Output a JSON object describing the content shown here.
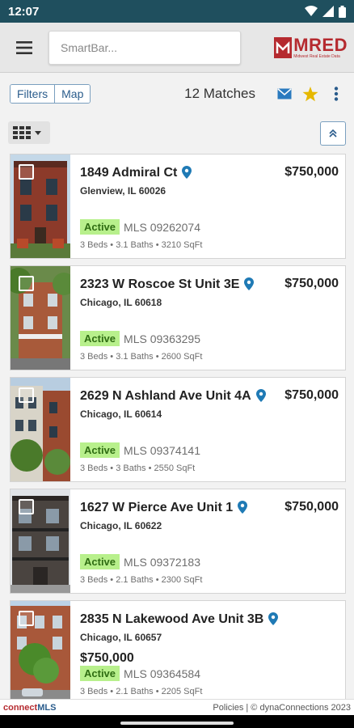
{
  "status": {
    "time": "12:07"
  },
  "topbar": {
    "search_placeholder": "SmartBar...",
    "logo_text": "MRED",
    "logo_sub": "Midwest Real Estate Data"
  },
  "toolbar": {
    "filters": "Filters",
    "map": "Map",
    "matches": "12 Matches"
  },
  "listings": [
    {
      "address": "1849 Admiral Ct",
      "city": "Glenview, IL 60026",
      "price": "$750,000",
      "status": "Active",
      "mls": "MLS 09262074",
      "details": "3 Beds • 3.1 Baths • 3210 SqFt"
    },
    {
      "address": "2323 W Roscoe St Unit 3E",
      "city": "Chicago, IL 60618",
      "price": "$750,000",
      "status": "Active",
      "mls": "MLS 09363295",
      "details": "3 Beds • 3.1 Baths • 2600 SqFt"
    },
    {
      "address": "2629 N Ashland Ave Unit 4A",
      "city": "Chicago, IL 60614",
      "price": "$750,000",
      "status": "Active",
      "mls": "MLS 09374141",
      "details": "3 Beds • 3 Baths • 2550 SqFt"
    },
    {
      "address": "1627 W Pierce Ave Unit 1",
      "city": "Chicago, IL 60622",
      "price": "$750,000",
      "status": "Active",
      "mls": "MLS 09372183",
      "details": "3 Beds • 2.1 Baths • 2300 SqFt"
    },
    {
      "address": "2835 N Lakewood Ave Unit 3B",
      "city": "Chicago, IL 60657",
      "price": "$750,000",
      "status": "Active",
      "mls": "MLS 09364584",
      "details": "3 Beds • 2.1 Baths • 2205 SqFt"
    }
  ],
  "footer": {
    "brand_a": "connect",
    "brand_b": "MLS",
    "right": "Policies | © dynaConnections 2023"
  },
  "colors": {
    "status_bar": "#1f4f5e",
    "accent": "#2a5c8c",
    "brand": "#b52a2f",
    "active_badge": "#b8f08c",
    "star": "#e6b800"
  }
}
